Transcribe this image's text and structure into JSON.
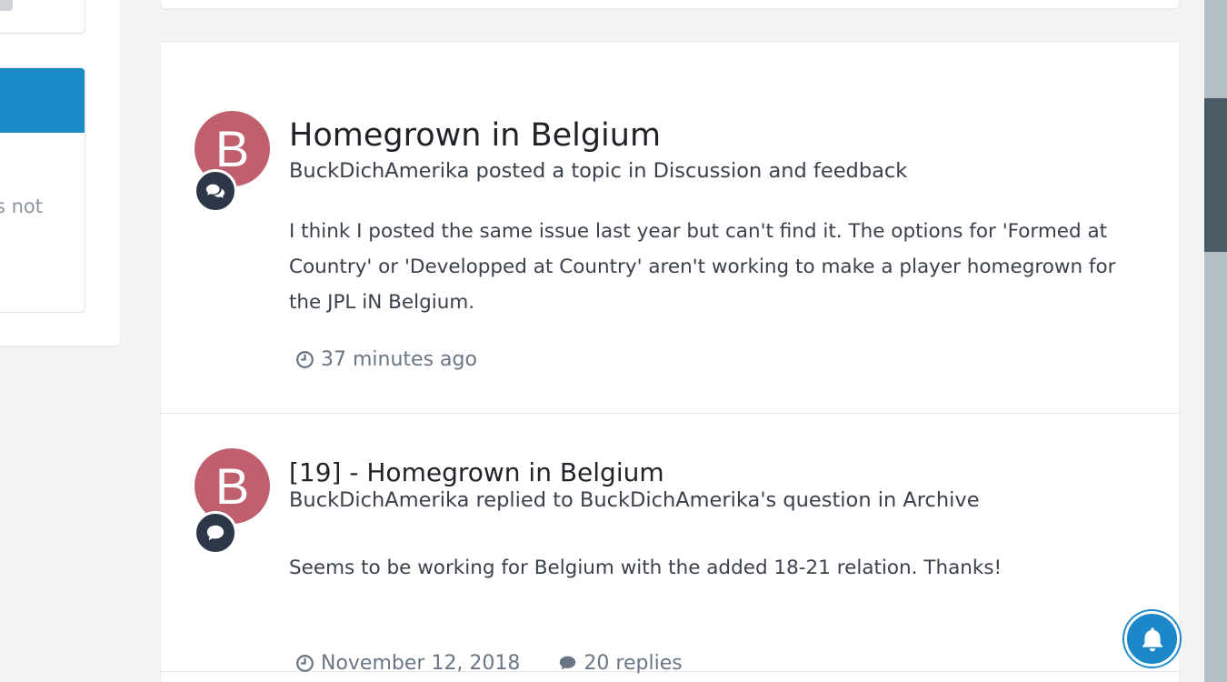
{
  "sidebar": {
    "partial_text": "s not"
  },
  "feed": {
    "items": [
      {
        "avatar_letter": "B",
        "title": "Homegrown in Belgium",
        "meta": "BuckDichAmerika posted a topic in Discussion and feedback",
        "body": "I think I posted the same issue last year but can't find it. The options for 'Formed at Country' or 'Developped at Country' aren't working to make a player homegrown for the JPL iN Belgium.",
        "time": "37 minutes ago",
        "badge_icon": "comments-icon"
      },
      {
        "avatar_letter": "B",
        "title": "[19] - Homegrown in Belgium",
        "meta": "BuckDichAmerika replied to BuckDichAmerika's question in Archive",
        "body": "Seems to be working for Belgium with the added 18-21 relation. Thanks!",
        "time": "November 12, 2018",
        "replies": "20 replies",
        "badge_icon": "comment-icon"
      }
    ]
  },
  "colors": {
    "avatar": "#c0606f",
    "badge": "#2d3747",
    "accent": "#1c87c9",
    "scroll_thumb": "#4b5b65"
  }
}
